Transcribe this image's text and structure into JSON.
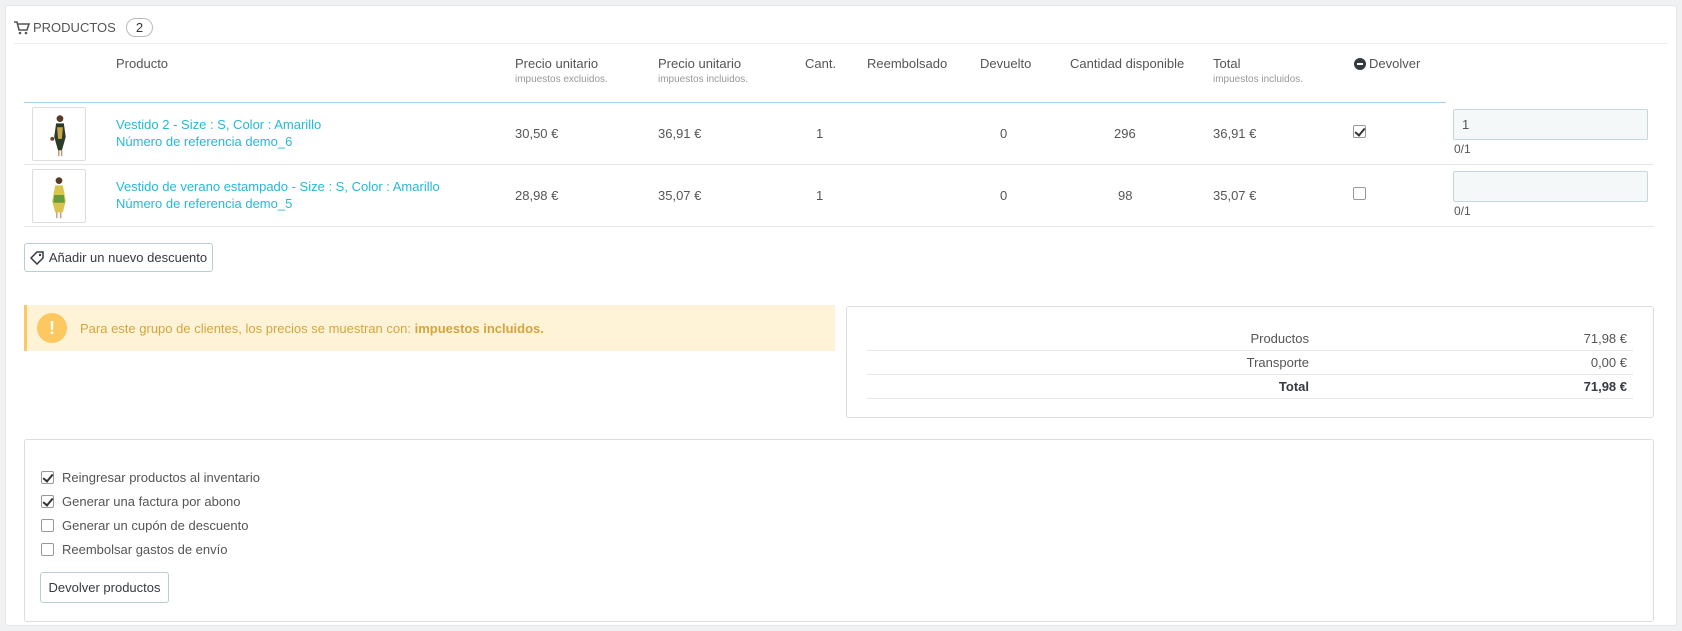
{
  "panel": {
    "title": "PRODUCTOS",
    "count": "2",
    "icon": "cart-icon"
  },
  "table": {
    "headers": {
      "product": "Producto",
      "unit_price_excl": "Precio unitario",
      "unit_price_excl_sub": "impuestos excluidos.",
      "unit_price_incl": "Precio unitario",
      "unit_price_incl_sub": "impuestos incluidos.",
      "qty": "Cant.",
      "refunded": "Reembolsado",
      "returned": "Devuelto",
      "available": "Cantidad disponible",
      "total": "Total",
      "total_sub": "impuestos incluidos.",
      "return": "Devolver"
    },
    "rows": [
      {
        "name": "Vestido 2 - Size : S, Color : Amarillo",
        "reference": "Número de referencia demo_6",
        "price_excl": "30,50 €",
        "price_incl": "36,91 €",
        "qty": "1",
        "refunded": "",
        "returned": "0",
        "available": "296",
        "total": "36,91 €",
        "return_checked": true,
        "return_qty": "1",
        "return_count": "0/1"
      },
      {
        "name": "Vestido de verano estampado - Size : S, Color : Amarillo",
        "reference": "Número de referencia demo_5",
        "price_excl": "28,98 €",
        "price_incl": "35,07 €",
        "qty": "1",
        "refunded": "",
        "returned": "0",
        "available": "98",
        "total": "35,07 €",
        "return_checked": false,
        "return_qty": "",
        "return_count": "0/1"
      }
    ]
  },
  "discount_button": "Añadir un nuevo descuento",
  "alert": {
    "text": "Para este grupo de clientes, los precios se muestran con:",
    "emphasis": "impuestos incluidos.",
    "icon": "exclamation-icon"
  },
  "totals": {
    "products_label": "Productos",
    "products_value": "71,98 €",
    "shipping_label": "Transporte",
    "shipping_value": "0,00 €",
    "total_label": "Total",
    "total_value": "71,98 €"
  },
  "options": [
    {
      "label": "Reingresar productos al inventario",
      "checked": true
    },
    {
      "label": "Generar una factura por abono",
      "checked": true
    },
    {
      "label": "Generar un cupón de descuento",
      "checked": false
    },
    {
      "label": "Reembolsar gastos de envío",
      "checked": false
    }
  ],
  "submit_button": "Devolver productos",
  "colors": {
    "link": "#25b9d7",
    "alert_bg": "#fff3d7",
    "alert_icon": "#fcc85f",
    "alert_text": "#d2a63c"
  }
}
